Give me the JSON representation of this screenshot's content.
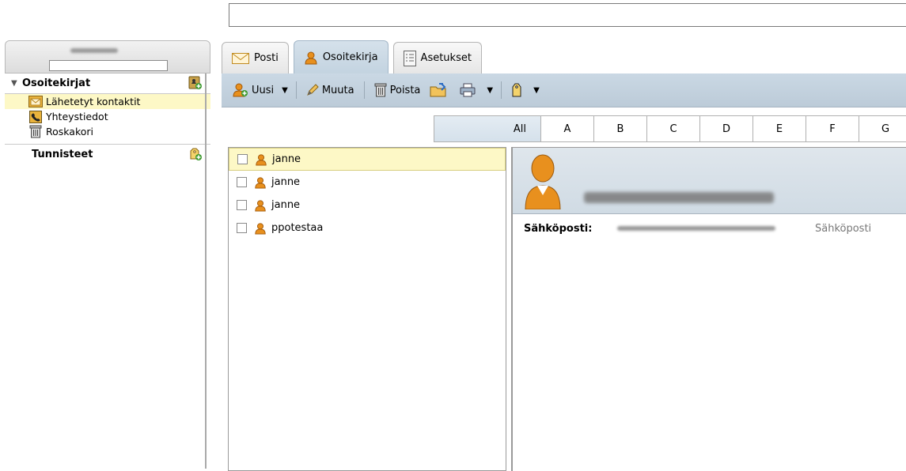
{
  "sidebar": {
    "address_books_title": "Osoitekirjat",
    "items": [
      {
        "label": "Lähetetyt kontaktit",
        "icon": "sent-contacts-icon"
      },
      {
        "label": "Yhteystiedot",
        "icon": "address-book-icon"
      },
      {
        "label": "Roskakori",
        "icon": "trash-icon"
      }
    ],
    "tags_title": "Tunnisteet"
  },
  "tabs": [
    {
      "label": "Posti",
      "icon": "mail-icon"
    },
    {
      "label": "Osoitekirja",
      "icon": "contact-icon",
      "active": true
    },
    {
      "label": "Asetukset",
      "icon": "settings-icon"
    }
  ],
  "toolbar": {
    "new_label": "Uusi",
    "edit_label": "Muuta",
    "delete_label": "Poista"
  },
  "alphabet": [
    "All",
    "A",
    "B",
    "C",
    "D",
    "E",
    "F",
    "G"
  ],
  "contacts": [
    {
      "name": "janne",
      "selected": true
    },
    {
      "name": "janne",
      "selected": false
    },
    {
      "name": "janne",
      "selected": false
    },
    {
      "name": "ppotestaa",
      "selected": false
    }
  ],
  "detail": {
    "email_label": "Sähköposti:",
    "email_type": "Sähköposti"
  },
  "colors": {
    "accent_blue": "#c3d3e0",
    "selection_yellow": "#fdf8c6",
    "contact_orange": "#e8901e"
  }
}
